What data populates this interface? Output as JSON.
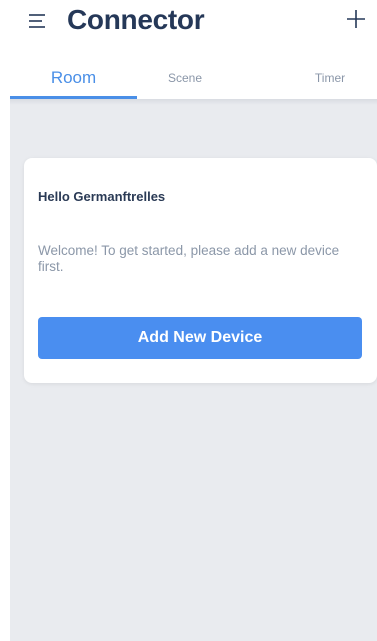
{
  "header": {
    "title": "Connector",
    "menu_icon": "menu-icon",
    "add_icon": "plus-icon"
  },
  "tabs": [
    {
      "label": "Room",
      "active": true
    },
    {
      "label": "Scene",
      "active": false
    },
    {
      "label": "Timer",
      "active": false
    }
  ],
  "card": {
    "greeting": "Hello Germanftrelles",
    "message": "Welcome! To get started, please add a new device first.",
    "button_label": "Add New Device"
  },
  "colors": {
    "accent": "#4a8fe7",
    "title": "#253858",
    "background": "#e9ebef"
  }
}
